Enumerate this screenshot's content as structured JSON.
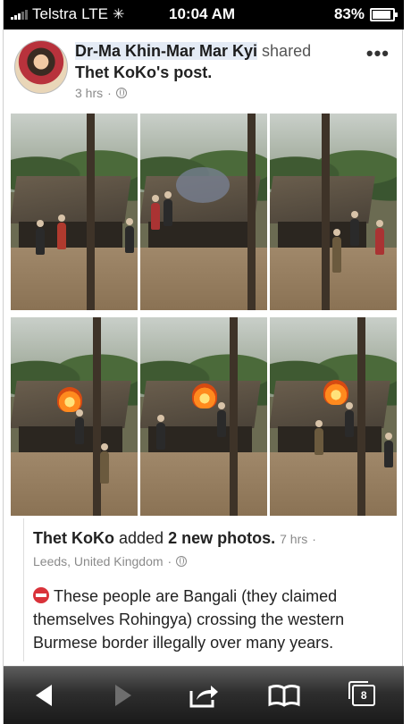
{
  "status_bar": {
    "carrier": "Telstra",
    "network": "LTE",
    "time": "10:04 AM",
    "battery": "83%",
    "battery_level": 0.83
  },
  "post": {
    "sharer_name": "Dr-Ma Khin-Mar Mar Kyi",
    "shared_text": "shared",
    "original_author_possessive": "Thet KoKo",
    "post_suffix": "'s post.",
    "time": "3 hrs",
    "privacy_separator": "·"
  },
  "photos": [
    {
      "id": "photo-1"
    },
    {
      "id": "photo-2"
    },
    {
      "id": "photo-3"
    },
    {
      "id": "photo-4"
    },
    {
      "id": "photo-5"
    },
    {
      "id": "photo-6"
    }
  ],
  "attribution": {
    "author": "Thet KoKo",
    "action": "added",
    "count_text": "2 new photos.",
    "time": "7 hrs",
    "location": "Leeds, United Kingdom",
    "separator": "·"
  },
  "body_text": "These people are Bangali (they claimed themselves Rohingya) crossing the western Burmese border illegally over many years.",
  "toolbar": {
    "tab_count": "8"
  },
  "icons": [
    "signal-icon",
    "loading-icon",
    "battery-icon",
    "avatar",
    "more-options-icon",
    "globe-icon",
    "no-entry-icon",
    "back-icon",
    "forward-icon",
    "share-icon",
    "bookmarks-icon",
    "tabs-icon"
  ]
}
